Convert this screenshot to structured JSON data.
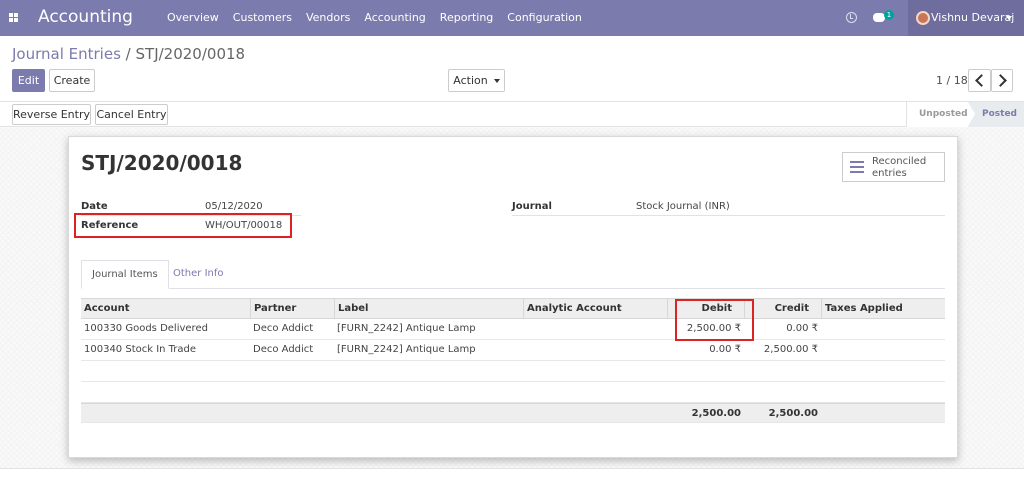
{
  "navbar": {
    "app_title": "Accounting",
    "menu": [
      "Overview",
      "Customers",
      "Vendors",
      "Accounting",
      "Reporting",
      "Configuration"
    ],
    "icons": [
      "apps-icon",
      "clock-icon",
      "chat-icon"
    ],
    "chat_count": "1",
    "user_name": "Vishnu Devaraj",
    "colors": {
      "navbar": "#7c7bad",
      "user_menu": "#6e6d9e",
      "badge": "#00a09d"
    }
  },
  "breadcrumb": {
    "parent": "Journal Entries",
    "separator": "/",
    "current": "STJ/2020/0018"
  },
  "buttons": {
    "edit": "Edit",
    "create": "Create",
    "action": "Action"
  },
  "pager": {
    "value": "1 / 18"
  },
  "statusbar": {
    "buttons": {
      "reverse": "Reverse Entry",
      "cancel": "Cancel Entry"
    },
    "steps": [
      "Unposted",
      "Posted"
    ],
    "active_step": "Posted"
  },
  "sheet": {
    "title": "STJ/2020/0018",
    "reconciled_button": {
      "line1": "Reconciled",
      "line2": "entries"
    },
    "fields": {
      "date": {
        "label": "Date",
        "value": "05/12/2020"
      },
      "reference": {
        "label": "Reference",
        "value": "WH/OUT/00018"
      },
      "journal": {
        "label": "Journal",
        "value": "Stock Journal (INR)"
      }
    },
    "tabs": [
      "Journal Items",
      "Other Info"
    ],
    "highlight_color": "#dd2222"
  },
  "journal_items": {
    "columns": [
      "Account",
      "Partner",
      "Label",
      "Analytic Account",
      "Debit",
      "Credit",
      "Taxes Applied"
    ],
    "rows": [
      {
        "account": "100330 Goods Delivered",
        "partner": "Deco Addict",
        "label": "[FURN_2242] Antique Lamp",
        "analytic": "",
        "debit": "2,500.00 ₹",
        "credit": "0.00 ₹",
        "taxes": ""
      },
      {
        "account": "100340 Stock In Trade",
        "partner": "Deco Addict",
        "label": "[FURN_2242] Antique Lamp",
        "analytic": "",
        "debit": "0.00 ₹",
        "credit": "2,500.00 ₹",
        "taxes": ""
      }
    ],
    "totals": {
      "debit": "2,500.00",
      "credit": "2,500.00"
    }
  }
}
